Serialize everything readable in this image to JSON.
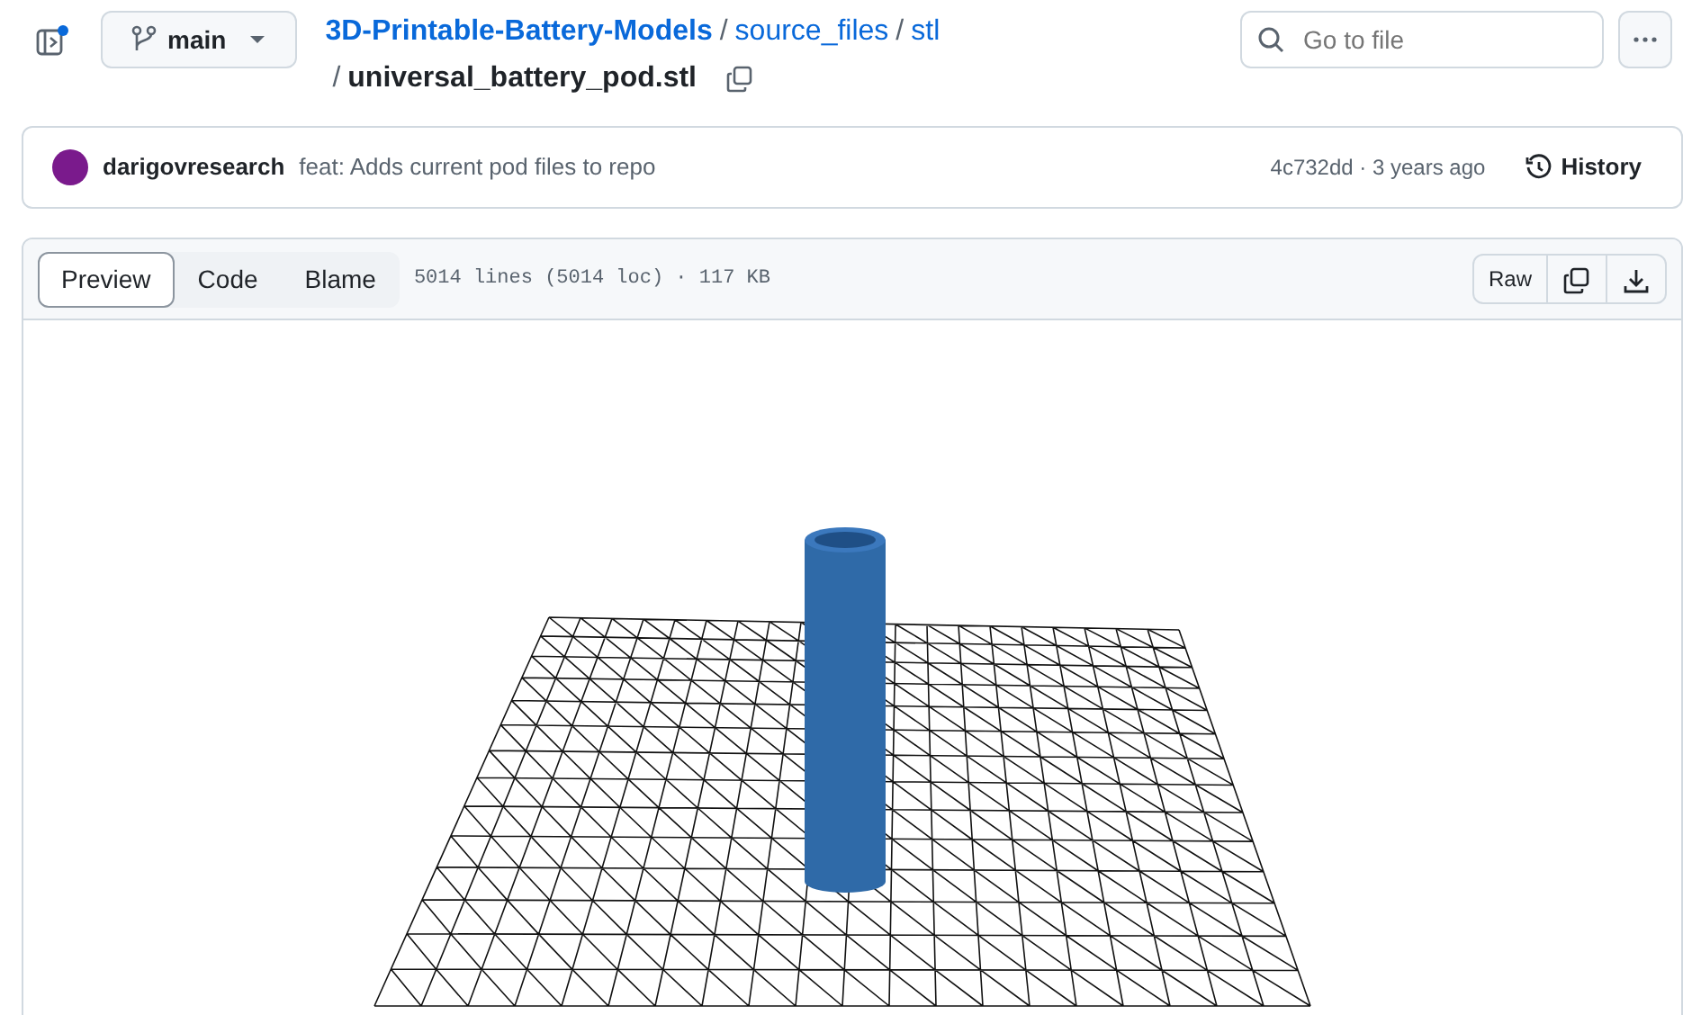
{
  "branch": "main",
  "breadcrumb": {
    "line_1": [
      {
        "kind": "repo",
        "text": "3D-Printable-Battery-Models"
      },
      {
        "kind": "separator",
        "text": "/"
      },
      {
        "kind": "folder",
        "text": "source_files"
      },
      {
        "kind": "separator",
        "text": "/"
      },
      {
        "kind": "folder",
        "text": "stl"
      }
    ],
    "line_2": [
      {
        "kind": "separator",
        "text": "/"
      },
      {
        "kind": "file",
        "text": "universal_battery_pod.stl"
      }
    ]
  },
  "search": {
    "placeholder": "Go to file"
  },
  "commit": {
    "author": "darigovresearch",
    "message": "feat: Adds current pod files to repo",
    "hash_age": "4c732dd · 3 years ago",
    "history": "History"
  },
  "tabs": [
    {
      "label": "Preview",
      "selected": true
    },
    {
      "label": "Code",
      "selected": false
    },
    {
      "label": "Blame",
      "selected": false
    }
  ],
  "file_info": "5014 lines (5014 loc) · 117 KB",
  "raw": "Raw"
}
